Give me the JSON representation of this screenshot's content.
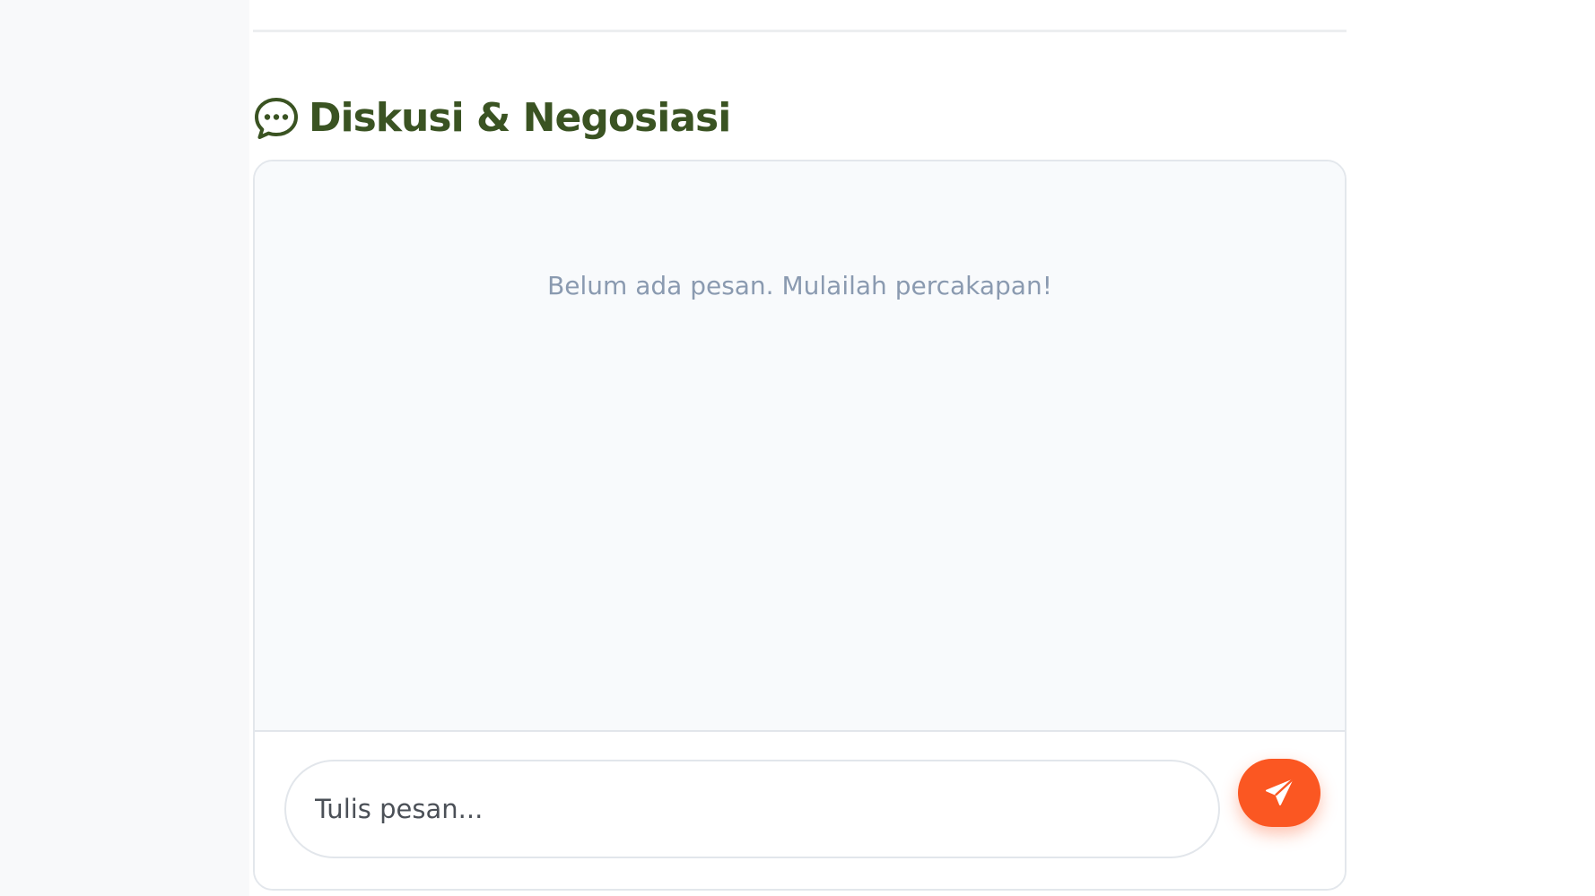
{
  "section": {
    "title": "Diskusi & Negosiasi",
    "icon": "chat-bubble-icon"
  },
  "chat": {
    "empty_text": "Belum ada pesan. Mulailah percakapan!",
    "input_placeholder": "Tulis pesan...",
    "input_value": "",
    "send_icon": "send-icon"
  },
  "colors": {
    "title": "#3a5322",
    "send_button": "#fb5722",
    "empty_text": "#8a9ab0",
    "messages_bg": "#f8fafc"
  }
}
